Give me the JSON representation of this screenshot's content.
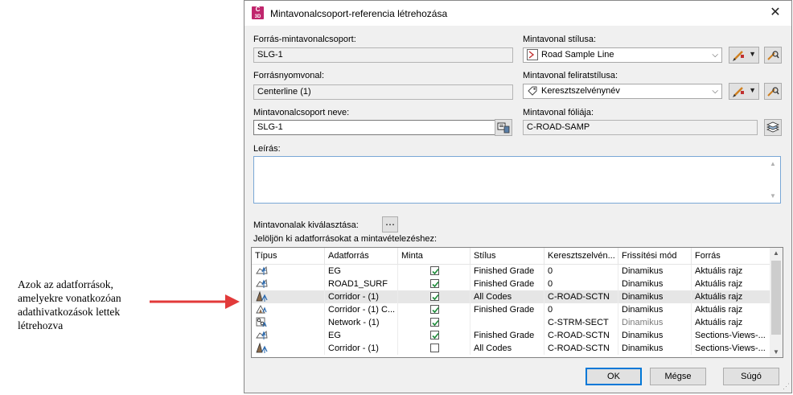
{
  "annotation": {
    "lines": [
      "Azok az adatforrások,",
      "amelyekre vonatkozóan",
      "adathivatkozások lettek",
      "létrehozva"
    ],
    "arrow_color": "#e23a3a"
  },
  "dialog": {
    "title": "Mintavonalcsoport-referencia létrehozása",
    "app_icon_text": "C 3D",
    "close_glyph": "✕",
    "source_group": {
      "label": "Forrás-mintavonalcsoport:",
      "value": "SLG-1"
    },
    "source_alignment": {
      "label": "Forrásnyomvonal:",
      "value": "Centerline (1)"
    },
    "group_name": {
      "label": "Mintavonalcsoport neve:",
      "value": "SLG-1"
    },
    "sample_line_style": {
      "label": "Mintavonal stílusa:",
      "value": "Road Sample Line"
    },
    "label_style": {
      "label": "Mintavonal feliratstílusa:",
      "value": "Keresztszelvénynév"
    },
    "layer": {
      "label": "Mintavonal fóliája:",
      "value": "C-ROAD-SAMP"
    },
    "description": {
      "label": "Leírás:",
      "value": ""
    },
    "select_lines": {
      "label": "Mintavonalak kiválasztása:",
      "button_glyph": "⋯"
    },
    "instruction": "Jelöljön ki adatforrásokat a mintavételezéshez:",
    "table": {
      "columns": [
        "Típus",
        "Adatforrás",
        "Minta",
        "Stílus",
        "Keresztszelvén...",
        "Frissítési mód",
        "Forrás"
      ],
      "rows": [
        {
          "type_icon": "surface-icon",
          "source": "EG",
          "sample": true,
          "style": "Finished Grade",
          "section": "0",
          "update": "Dinamikus",
          "origin": "Aktuális rajz",
          "selected": false,
          "update_gray": false
        },
        {
          "type_icon": "surface-icon",
          "source": "ROAD1_SURF",
          "sample": true,
          "style": "Finished Grade",
          "section": "0",
          "update": "Dinamikus",
          "origin": "Aktuális rajz",
          "selected": false,
          "update_gray": false
        },
        {
          "type_icon": "corridor-icon",
          "source": "Corridor - (1)",
          "sample": true,
          "style": "All Codes",
          "section": "C-ROAD-SCTN",
          "update": "Dinamikus",
          "origin": "Aktuális rajz",
          "selected": true,
          "update_gray": false
        },
        {
          "type_icon": "corridor-surface-icon",
          "source": "Corridor - (1) C...",
          "sample": true,
          "style": "Finished Grade",
          "section": "0",
          "update": "Dinamikus",
          "origin": "Aktuális rajz",
          "selected": false,
          "update_gray": false
        },
        {
          "type_icon": "pipe-network-icon",
          "source": "Network - (1)",
          "sample": true,
          "style": "",
          "section": "C-STRM-SECT",
          "update": "Dinamikus",
          "origin": "Aktuális rajz",
          "selected": false,
          "update_gray": true
        },
        {
          "type_icon": "surface-icon",
          "source": "EG",
          "sample": true,
          "style": "Finished Grade",
          "section": "C-ROAD-SCTN",
          "update": "Dinamikus",
          "origin": "Sections-Views-...",
          "selected": false,
          "update_gray": false
        },
        {
          "type_icon": "corridor-icon",
          "source": "Corridor - (1)",
          "sample": false,
          "style": "All Codes",
          "section": "C-ROAD-SCTN",
          "update": "Dinamikus",
          "origin": "Sections-Views-...",
          "selected": false,
          "update_gray": false
        }
      ]
    },
    "buttons": {
      "ok": "OK",
      "cancel": "Mégse",
      "help": "Súgó"
    }
  }
}
